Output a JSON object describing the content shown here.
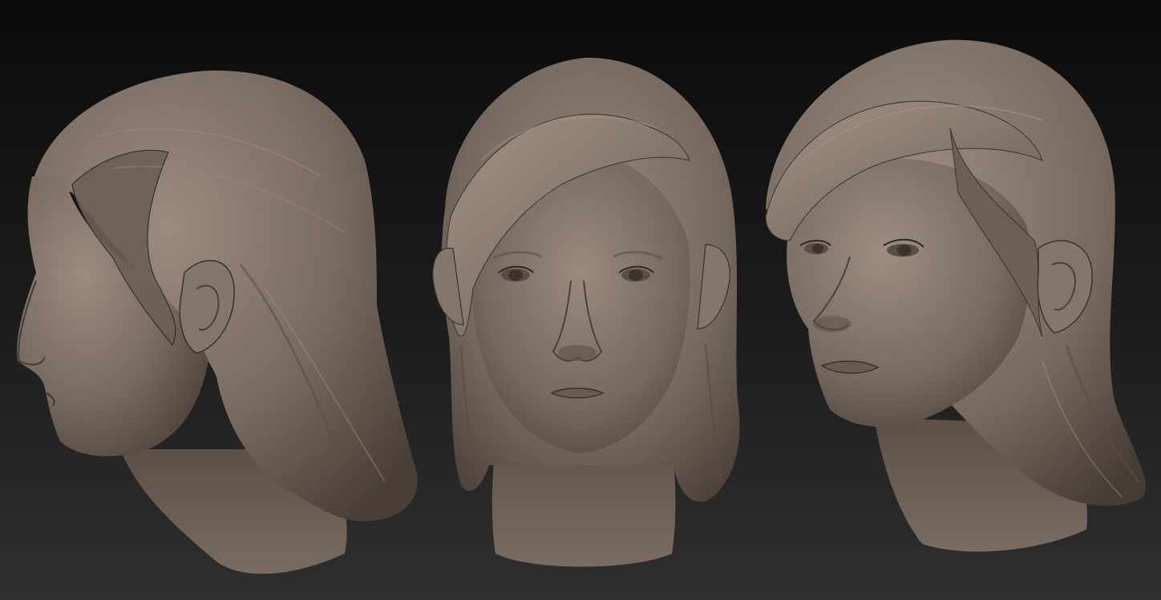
{
  "scene": {
    "background_top": "#0b0b0b",
    "background_bottom": "#2d2d2d",
    "clay_color": "#7a6b61",
    "clay_highlight": "#9c8c80",
    "clay_shadow": "#3e3530"
  },
  "views": [
    {
      "view": "left-profile"
    },
    {
      "view": "front"
    },
    {
      "view": "three-quarter-right"
    }
  ]
}
